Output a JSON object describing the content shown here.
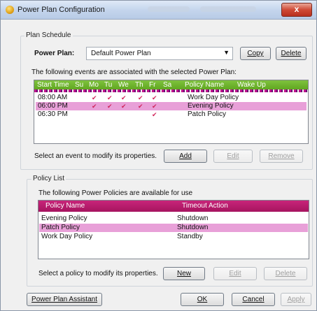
{
  "window": {
    "title": "Power Plan Configuration",
    "close_label": "x"
  },
  "plan_schedule": {
    "group_label": "Plan Schedule",
    "power_plan_label": "Power Plan:",
    "power_plan_value": "Default Power Plan",
    "copy_label": "Copy",
    "delete_label": "Delete",
    "events_caption": "The following events are associated with the selected Power Plan:",
    "columns": [
      "Start Time",
      "Su",
      "Mo",
      "Tu",
      "We",
      "Th",
      "Fr",
      "Sa",
      "Policy Name",
      "Wake Up"
    ],
    "events": [
      {
        "start": "08:00 AM",
        "days": [
          false,
          true,
          true,
          true,
          true,
          true,
          false
        ],
        "policy": "Work Day Policy",
        "selected": false
      },
      {
        "start": "06:00 PM",
        "days": [
          false,
          true,
          true,
          true,
          true,
          true,
          false
        ],
        "policy": "Evening Policy",
        "selected": true
      },
      {
        "start": "06:30 PM",
        "days": [
          false,
          false,
          false,
          false,
          false,
          true,
          false
        ],
        "policy": "Patch Policy",
        "selected": false
      }
    ],
    "check_glyph": "✔",
    "hint": "Select an event to modify its properties.",
    "add_label": "Add",
    "edit_label": "Edit",
    "remove_label": "Remove"
  },
  "policy_list": {
    "group_label": "Policy List",
    "caption": "The following Power Policies are available for use",
    "columns": [
      "Policy Name",
      "Timeout Action"
    ],
    "policies": [
      {
        "name": "Evening Policy",
        "action": "Shutdown",
        "selected": false
      },
      {
        "name": "Patch Policy",
        "action": "Shutdown",
        "selected": true
      },
      {
        "name": "Work Day Policy",
        "action": "Standby",
        "selected": false
      }
    ],
    "hint": "Select a policy to modify its properties.",
    "new_label": "New",
    "edit_label": "Edit",
    "delete_label": "Delete"
  },
  "footer": {
    "assistant_label": "Power Plan Assistant",
    "ok_label": "OK",
    "cancel_label": "Cancel",
    "apply_label": "Apply"
  },
  "icons": {
    "app": "power-plan-icon",
    "dropdown": "chevron-down-icon",
    "close": "close-icon"
  }
}
